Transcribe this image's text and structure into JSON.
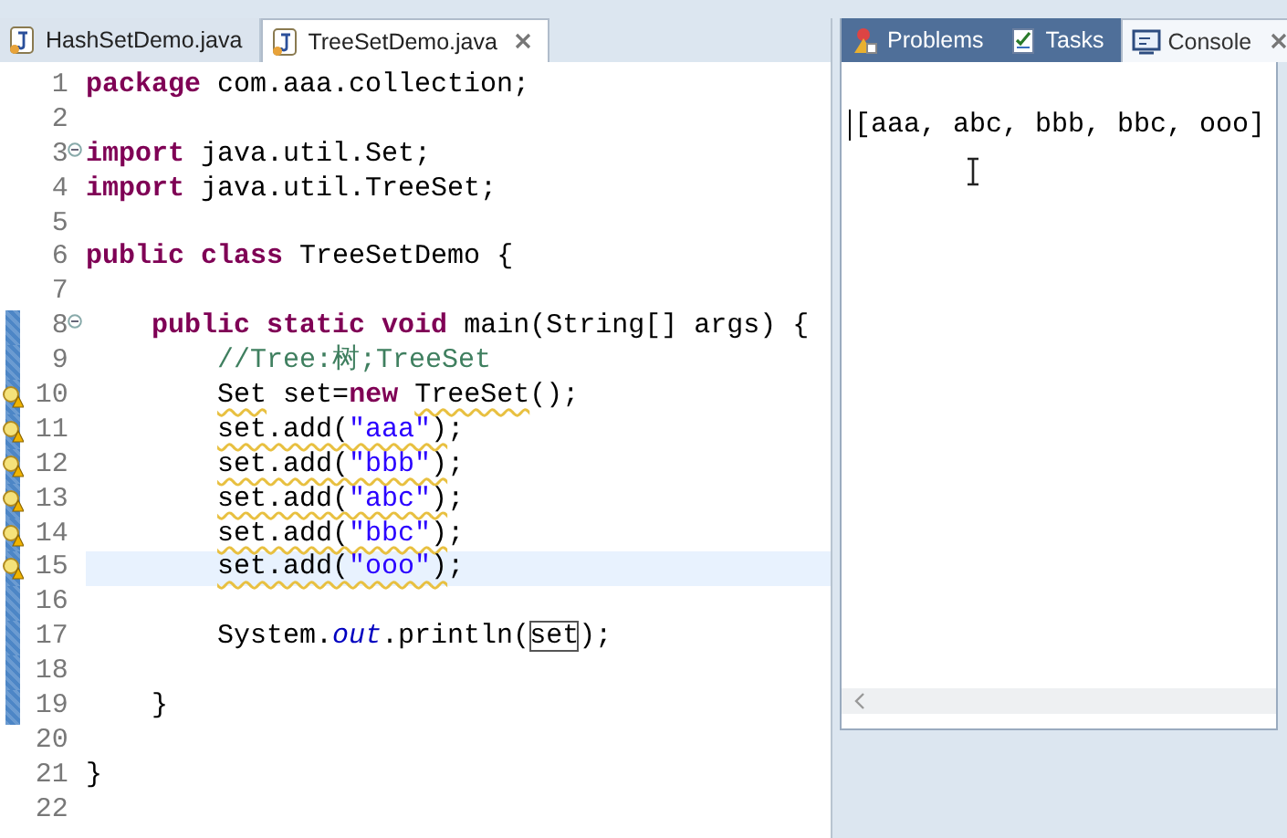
{
  "editor": {
    "tabs": [
      {
        "label": "HashSetDemo.java",
        "selected": false,
        "closable": false
      },
      {
        "label": "TreeSetDemo.java",
        "selected": true,
        "closable": true
      }
    ],
    "lines": [
      {
        "number": "1",
        "fold": false,
        "warning": false,
        "changed": false,
        "current": false,
        "tokens": [
          {
            "kind": "keyword",
            "t": "package"
          },
          {
            "kind": "plain",
            "t": " com.aaa.collection;"
          }
        ]
      },
      {
        "number": "2",
        "fold": false,
        "warning": false,
        "changed": false,
        "current": false
      },
      {
        "number": "3",
        "fold": true,
        "warning": false,
        "changed": false,
        "current": false,
        "tokens": [
          {
            "kind": "keyword",
            "t": "import"
          },
          {
            "kind": "plain",
            "t": " java.util.Set;"
          }
        ]
      },
      {
        "number": "4",
        "fold": false,
        "warning": false,
        "changed": false,
        "current": false,
        "tokens": [
          {
            "kind": "keyword",
            "t": "import"
          },
          {
            "kind": "plain",
            "t": " java.util.TreeSet;"
          }
        ]
      },
      {
        "number": "5",
        "fold": false,
        "warning": false,
        "changed": false,
        "current": false
      },
      {
        "number": "6",
        "fold": false,
        "warning": false,
        "changed": false,
        "current": false,
        "tokens": [
          {
            "kind": "keyword",
            "t": "public class"
          },
          {
            "kind": "plain",
            "t": " TreeSetDemo {"
          }
        ]
      },
      {
        "number": "7",
        "fold": false,
        "warning": false,
        "changed": false,
        "current": false
      },
      {
        "number": "8",
        "fold": true,
        "warning": false,
        "changed": true,
        "current": false,
        "tokens": [
          {
            "kind": "keyword",
            "t": "    public static void"
          },
          {
            "kind": "plain",
            "t": " main(String[] args) {"
          }
        ]
      },
      {
        "number": "9",
        "fold": false,
        "warning": false,
        "changed": true,
        "current": false,
        "tokens": [
          {
            "kind": "comment",
            "t": "        //Tree:树;TreeSet"
          }
        ]
      },
      {
        "number": "10",
        "fold": false,
        "warning": true,
        "changed": true,
        "current": false,
        "tokens": [
          {
            "kind": "plain",
            "t": "        Set",
            "warn": true
          },
          {
            "kind": "plain",
            "t": " set="
          },
          {
            "kind": "keyword",
            "t": "new"
          },
          {
            "kind": "plain",
            "t": " TreeSet",
            "warn": true
          },
          {
            "kind": "plain",
            "t": "();"
          }
        ]
      },
      {
        "number": "11",
        "fold": false,
        "warning": true,
        "changed": true,
        "current": false,
        "tokens": [
          {
            "kind": "plain",
            "t": "        set.add(",
            "warn": true
          },
          {
            "kind": "string",
            "t": "\"aaa\"",
            "warn": true
          },
          {
            "kind": "plain",
            "t": ")",
            "warn": true
          },
          {
            "kind": "plain",
            "t": ";"
          }
        ]
      },
      {
        "number": "12",
        "fold": false,
        "warning": true,
        "changed": true,
        "current": false,
        "tokens": [
          {
            "kind": "plain",
            "t": "        set.add(",
            "warn": true
          },
          {
            "kind": "string",
            "t": "\"bbb\"",
            "warn": true
          },
          {
            "kind": "plain",
            "t": ")",
            "warn": true
          },
          {
            "kind": "plain",
            "t": ";"
          }
        ]
      },
      {
        "number": "13",
        "fold": false,
        "warning": true,
        "changed": true,
        "current": false,
        "tokens": [
          {
            "kind": "plain",
            "t": "        set.add(",
            "warn": true
          },
          {
            "kind": "string",
            "t": "\"abc\"",
            "warn": true
          },
          {
            "kind": "plain",
            "t": ")",
            "warn": true
          },
          {
            "kind": "plain",
            "t": ";"
          }
        ]
      },
      {
        "number": "14",
        "fold": false,
        "warning": true,
        "changed": true,
        "current": false,
        "tokens": [
          {
            "kind": "plain",
            "t": "        set.add(",
            "warn": true
          },
          {
            "kind": "string",
            "t": "\"bbc\"",
            "warn": true
          },
          {
            "kind": "plain",
            "t": ")",
            "warn": true
          },
          {
            "kind": "plain",
            "t": ";"
          }
        ]
      },
      {
        "number": "15",
        "fold": false,
        "warning": true,
        "changed": true,
        "current": true,
        "tokens": [
          {
            "kind": "plain",
            "t": "        set.add(",
            "warn": true
          },
          {
            "kind": "string",
            "t": "\"ooo\"",
            "warn": true
          },
          {
            "kind": "plain",
            "t": ")",
            "warn": true
          },
          {
            "kind": "plain",
            "t": ";"
          }
        ]
      },
      {
        "number": "16",
        "fold": false,
        "warning": false,
        "changed": true,
        "current": false
      },
      {
        "number": "17",
        "fold": false,
        "warning": false,
        "changed": true,
        "current": false,
        "tokens": [
          {
            "kind": "plain",
            "t": "        System."
          },
          {
            "kind": "field",
            "t": "out"
          },
          {
            "kind": "plain",
            "t": ".println("
          },
          {
            "kind": "boxed",
            "t": "set"
          },
          {
            "kind": "plain",
            "t": ");"
          }
        ]
      },
      {
        "number": "18",
        "fold": false,
        "warning": false,
        "changed": true,
        "current": false
      },
      {
        "number": "19",
        "fold": false,
        "warning": false,
        "changed": true,
        "current": false,
        "tokens": [
          {
            "kind": "plain",
            "t": "    }"
          }
        ]
      },
      {
        "number": "20",
        "fold": false,
        "warning": false,
        "changed": false,
        "current": false
      },
      {
        "number": "21",
        "fold": false,
        "warning": false,
        "changed": false,
        "current": false,
        "tokens": [
          {
            "kind": "plain",
            "t": "}"
          }
        ]
      },
      {
        "number": "22",
        "fold": false,
        "warning": false,
        "changed": false,
        "current": false
      }
    ]
  },
  "console_panel": {
    "tabs": [
      {
        "label": "Problems",
        "kind": "problems",
        "selected": false,
        "closable": false
      },
      {
        "label": "Tasks",
        "kind": "tasks",
        "selected": false,
        "closable": false
      },
      {
        "label": "Console",
        "kind": "console",
        "selected": true,
        "closable": true
      }
    ],
    "output": "[aaa, abc, bbb, bbc, ooo]"
  }
}
